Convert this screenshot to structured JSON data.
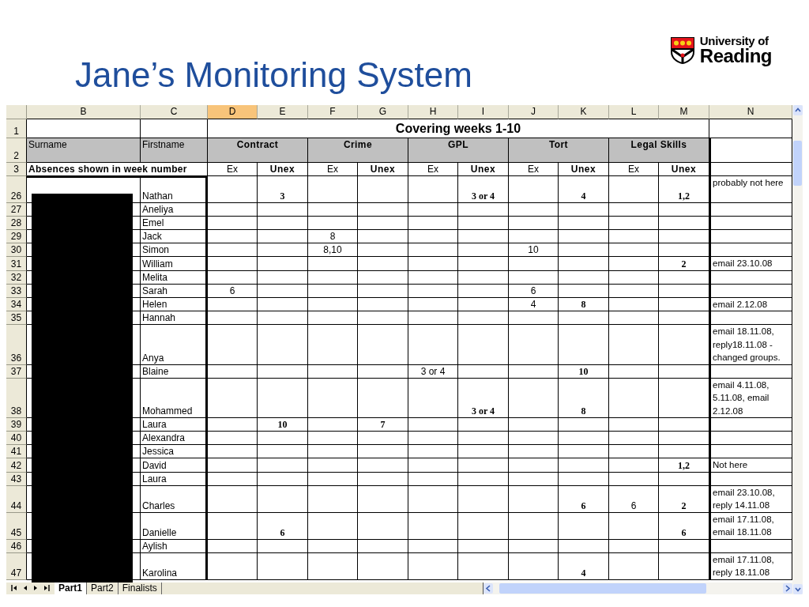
{
  "slide": {
    "title": "Jane’s Monitoring System",
    "logo": {
      "line_1": "University of",
      "line_2": "Reading"
    }
  },
  "sheet": {
    "columns": [
      {
        "label": "B",
        "selected": false
      },
      {
        "label": "C",
        "selected": false
      },
      {
        "label": "D",
        "selected": true
      },
      {
        "label": "E",
        "selected": false
      },
      {
        "label": "F",
        "selected": false
      },
      {
        "label": "G",
        "selected": false
      },
      {
        "label": "H",
        "selected": false
      },
      {
        "label": "I",
        "selected": false
      },
      {
        "label": "J",
        "selected": false
      },
      {
        "label": "K",
        "selected": false
      },
      {
        "label": "L",
        "selected": false
      },
      {
        "label": "M",
        "selected": false
      },
      {
        "label": "N",
        "selected": false
      }
    ],
    "title_row": {
      "number": "1",
      "title": "Covering weeks 1-10"
    },
    "header_row": {
      "number": "2",
      "surname": "Surname",
      "firstname": "Firstname",
      "subjects": [
        "Contract",
        "Crime",
        "GPL",
        "Tort",
        "Legal Skills"
      ]
    },
    "sub_row": {
      "number": "3",
      "label": "Absences shown in week number",
      "sub_headers": [
        {
          "label": "Ex",
          "kind": "excused"
        },
        {
          "label": "Unex",
          "kind": "unexcused"
        },
        {
          "label": "Ex",
          "kind": "excused"
        },
        {
          "label": "Unex",
          "kind": "unexcused"
        },
        {
          "label": "Ex",
          "kind": "excused"
        },
        {
          "label": "Unex",
          "kind": "unexcused"
        },
        {
          "label": "Ex",
          "kind": "excused"
        },
        {
          "label": "Unex",
          "kind": "unexcused"
        },
        {
          "label": "Ex",
          "kind": "excused"
        },
        {
          "label": "Unex",
          "kind": "unexcused"
        }
      ]
    },
    "rows": [
      {
        "number": "26",
        "cells": [
          "",
          "Nathan",
          "",
          "3",
          "",
          "",
          "",
          "3 or 4",
          "",
          "4",
          "",
          "1,2",
          "probably not here"
        ]
      },
      {
        "number": "27",
        "cells": [
          "",
          "Aneliya",
          "",
          "",
          "",
          "",
          "",
          "",
          "",
          "",
          "",
          "",
          ""
        ]
      },
      {
        "number": "28",
        "cells": [
          "",
          "Emel",
          "",
          "",
          "",
          "",
          "",
          "",
          "",
          "",
          "",
          "",
          ""
        ]
      },
      {
        "number": "29",
        "cells": [
          "",
          "Jack",
          "",
          "",
          "8",
          "",
          "",
          "",
          "",
          "",
          "",
          "",
          ""
        ]
      },
      {
        "number": "30",
        "cells": [
          "",
          "Simon",
          "",
          "",
          "8,10",
          "",
          "",
          "",
          "10",
          "",
          "",
          "",
          ""
        ]
      },
      {
        "number": "31",
        "cells": [
          "",
          "William",
          "",
          "",
          "",
          "",
          "",
          "",
          "",
          "",
          "",
          "2",
          "email 23.10.08"
        ]
      },
      {
        "number": "32",
        "cells": [
          "",
          "Melita",
          "",
          "",
          "",
          "",
          "",
          "",
          "",
          "",
          "",
          "",
          ""
        ]
      },
      {
        "number": "33",
        "cells": [
          "",
          "Sarah",
          "6",
          "",
          "",
          "",
          "",
          "",
          "6",
          "",
          "",
          "",
          ""
        ]
      },
      {
        "number": "34",
        "cells": [
          "",
          "Helen",
          "",
          "",
          "",
          "",
          "",
          "",
          "4",
          "8",
          "",
          "",
          "email 2.12.08"
        ]
      },
      {
        "number": "35",
        "cells": [
          "",
          "Hannah",
          "",
          "",
          "",
          "",
          "",
          "",
          "",
          "",
          "",
          "",
          ""
        ]
      },
      {
        "number": "36",
        "cells": [
          "",
          "Anya",
          "",
          "",
          "",
          "",
          "",
          "",
          "",
          "",
          "",
          "",
          "email 18.11.08, reply18.11.08 - changed groups."
        ]
      },
      {
        "number": "37",
        "cells": [
          "",
          "Blaine",
          "",
          "",
          "",
          "",
          "3 or 4",
          "",
          "",
          "10",
          "",
          "",
          ""
        ]
      },
      {
        "number": "38",
        "cells": [
          "",
          "Mohammed",
          "",
          "",
          "",
          "",
          "",
          "3 or 4",
          "",
          "8",
          "",
          "",
          "email 4.11.08, 5.11.08, email 2.12.08"
        ]
      },
      {
        "number": "39",
        "cells": [
          "",
          "Laura",
          "",
          "10",
          "",
          "7",
          "",
          "",
          "",
          "",
          "",
          "",
          ""
        ]
      },
      {
        "number": "40",
        "cells": [
          "",
          "Alexandra",
          "",
          "",
          "",
          "",
          "",
          "",
          "",
          "",
          "",
          "",
          ""
        ]
      },
      {
        "number": "41",
        "cells": [
          "",
          "Jessica",
          "",
          "",
          "",
          "",
          "",
          "",
          "",
          "",
          "",
          "",
          ""
        ]
      },
      {
        "number": "42",
        "cells": [
          "",
          "David",
          "",
          "",
          "",
          "",
          "",
          "",
          "",
          "",
          "",
          "1,2",
          "Not here"
        ]
      },
      {
        "number": "43",
        "cells": [
          "",
          "Laura",
          "",
          "",
          "",
          "",
          "",
          "",
          "",
          "",
          "",
          "",
          ""
        ]
      },
      {
        "number": "44",
        "cells": [
          "",
          "Charles",
          "",
          "",
          "",
          "",
          "",
          "",
          "",
          "6",
          "6",
          "2",
          "email 23.10.08, reply 14.11.08"
        ]
      },
      {
        "number": "45",
        "cells": [
          "",
          "Danielle",
          "",
          "6",
          "",
          "",
          "",
          "",
          "",
          "",
          "",
          "6",
          "email 17.11.08, email 18.11.08"
        ]
      },
      {
        "number": "46",
        "cells": [
          "",
          "Aylish",
          "",
          "",
          "",
          "",
          "",
          "",
          "",
          "",
          "",
          "",
          ""
        ]
      },
      {
        "number": "47",
        "cells": [
          "",
          "Karolina",
          "",
          "",
          "",
          "",
          "",
          "",
          "",
          "4",
          "",
          "",
          "email 17.11.08, reply 18.11.08"
        ]
      }
    ],
    "tabs": [
      {
        "label": "Part1",
        "selected": true
      },
      {
        "label": "Part2",
        "selected": false
      },
      {
        "label": "Finalists",
        "selected": false
      }
    ]
  }
}
